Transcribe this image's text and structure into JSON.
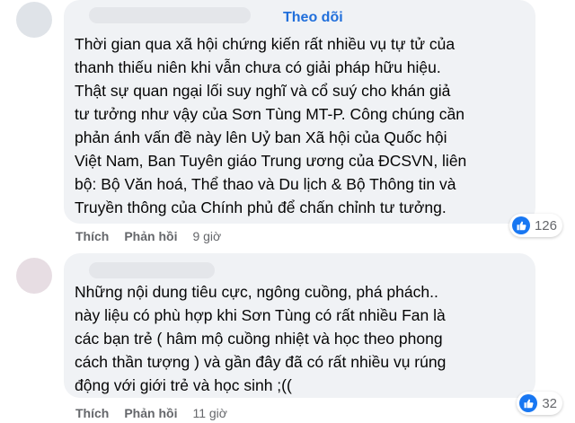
{
  "comments": [
    {
      "follow_label": "Theo dõi",
      "text": "Thời gian qua xã hội chứng kiến rất nhiều vụ tự tử của\nthanh thiếu niên khi vẫn chưa có giải pháp hữu hiệu.\nThật sự quan ngại lối suy nghĩ và cổ suý cho khán giả\ntư tưởng như vậy của Sơn Tùng MT-P. Công chúng cần\nphản ánh vấn đề này lên Uỷ ban Xã hội của Quốc hội\nViệt Nam, Ban Tuyên giáo Trung ương của ĐCSVN, liên\nbộ: Bộ Văn hoá, Thể thao và Du lịch & Bộ Thông tin và\nTruyền thông của Chính phủ để chấn chỉnh tư tưởng.",
      "like_count": "126",
      "like_label": "Thích",
      "reply_label": "Phản hồi",
      "time": "9 giờ"
    },
    {
      "text": "Những nội dung tiêu cực, ngông cuồng, phá phách..\nnày liệu có phù hợp khi Sơn Tùng có rất nhiều Fan là\ncác bạn trẻ ( hâm mộ cuồng nhiệt và học theo phong\ncách thần tượng ) và gần đây đã có rất nhiều vụ rúng\nđộng với giới trẻ và học sinh ;((",
      "like_count": "32",
      "like_label": "Thích",
      "reply_label": "Phản hồi",
      "time": "11 giờ"
    }
  ],
  "colors": {
    "bubble": "#f0f2f5",
    "link_blue": "#216fdb",
    "like_blue": "#1877f2",
    "meta_gray": "#65676b"
  },
  "icons": [
    "like-icon"
  ]
}
